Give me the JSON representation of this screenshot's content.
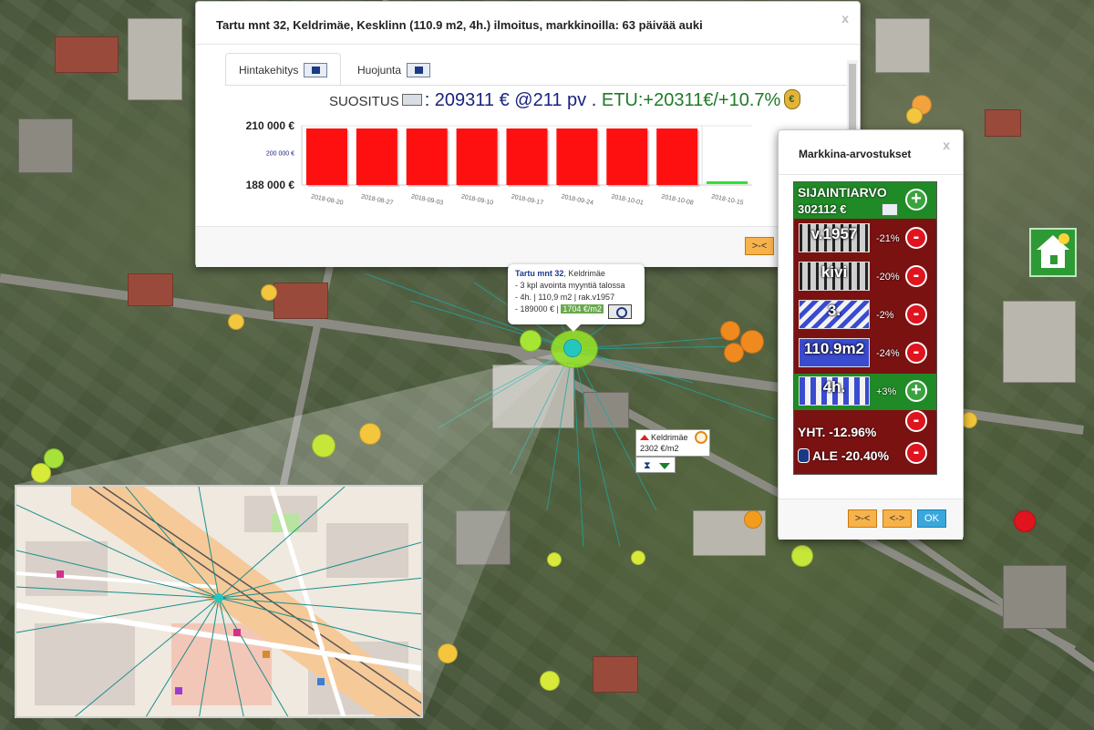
{
  "dialog": {
    "title": "Tartu mnt 32, Keldrimäe, Kesklinn (110.9 m2, 4h.) ilmoitus, markkinoilla: 63 päivää auki",
    "close_label": "x",
    "tabs": [
      {
        "label": "Hintakehitys",
        "icon": "search-icon"
      },
      {
        "label": "Huojunta",
        "icon": "search-icon"
      }
    ],
    "recommendation": {
      "label": "SUOSITUS",
      "price": ": 209311 € @211 pv",
      "separator": ".",
      "benefit": "ETU:+20311€/+10.7%",
      "icon": "moneybag-icon"
    },
    "footer_button": ">-<"
  },
  "chart_data": {
    "type": "bar",
    "ylim": [
      188000,
      210000
    ],
    "yticks": [
      {
        "value": 210000,
        "label": "210 000 €"
      },
      {
        "value": 200000,
        "label": "200 000 €"
      },
      {
        "value": 188000,
        "label": "188 000 €"
      }
    ],
    "categories": [
      "2018-08-20",
      "2018-08-27",
      "2018-09-03",
      "2018-09-10",
      "2018-09-17",
      "2018-09-24",
      "2018-10-01",
      "2018-10-08",
      "2018-10-15"
    ],
    "values": [
      209000,
      209000,
      209000,
      209000,
      209000,
      209000,
      209000,
      209000,
      188700
    ],
    "colors": [
      "#ff1010",
      "#ff1010",
      "#ff1010",
      "#ff1010",
      "#ff1010",
      "#ff1010",
      "#ff1010",
      "#ff1010",
      "#33dd33"
    ]
  },
  "tooltip": {
    "street": "Tartu mnt 32",
    "district": ", Keldrimäe",
    "line1": "- 3 kpl avointa myyntiä talossa",
    "line2": "- 4h. | 110,9 m2 | rak.v1957",
    "line3": "- 189000 € |",
    "price_per_m2": "1704 €/m2",
    "zoom_icon": "zoom-icon"
  },
  "district_badge": {
    "name": "Keldrimäe",
    "price": "2302 €/m2"
  },
  "market": {
    "title": "Markkina-arvostukset",
    "close_label": "x",
    "location_label": "SIJAINTIARVO",
    "location_value": "302112 €",
    "rows": [
      {
        "caption": "v.1957",
        "pct": "-21%",
        "sign": "-"
      },
      {
        "caption": "kivi",
        "pct": "-20%",
        "sign": "-"
      },
      {
        "caption": "3.",
        "pct": "-2%",
        "sign": "-"
      },
      {
        "caption": "110.9m2",
        "pct": "-24%",
        "sign": "-"
      },
      {
        "caption": "4h.",
        "pct": "+3%",
        "sign": "+"
      }
    ],
    "total_label": "YHT. -12.96%",
    "discount_label": "ALE -20.40%",
    "buttons": {
      "shrink": ">-<",
      "expand": "<->",
      "ok": "OK"
    }
  },
  "colors": {
    "accent_blue": "#1a237e",
    "accent_green": "#1f7a2a",
    "panel_red": "#7a1212",
    "panel_green": "#1f8a26",
    "button_orange": "#f7b24a",
    "button_blue": "#3aa7dc"
  }
}
